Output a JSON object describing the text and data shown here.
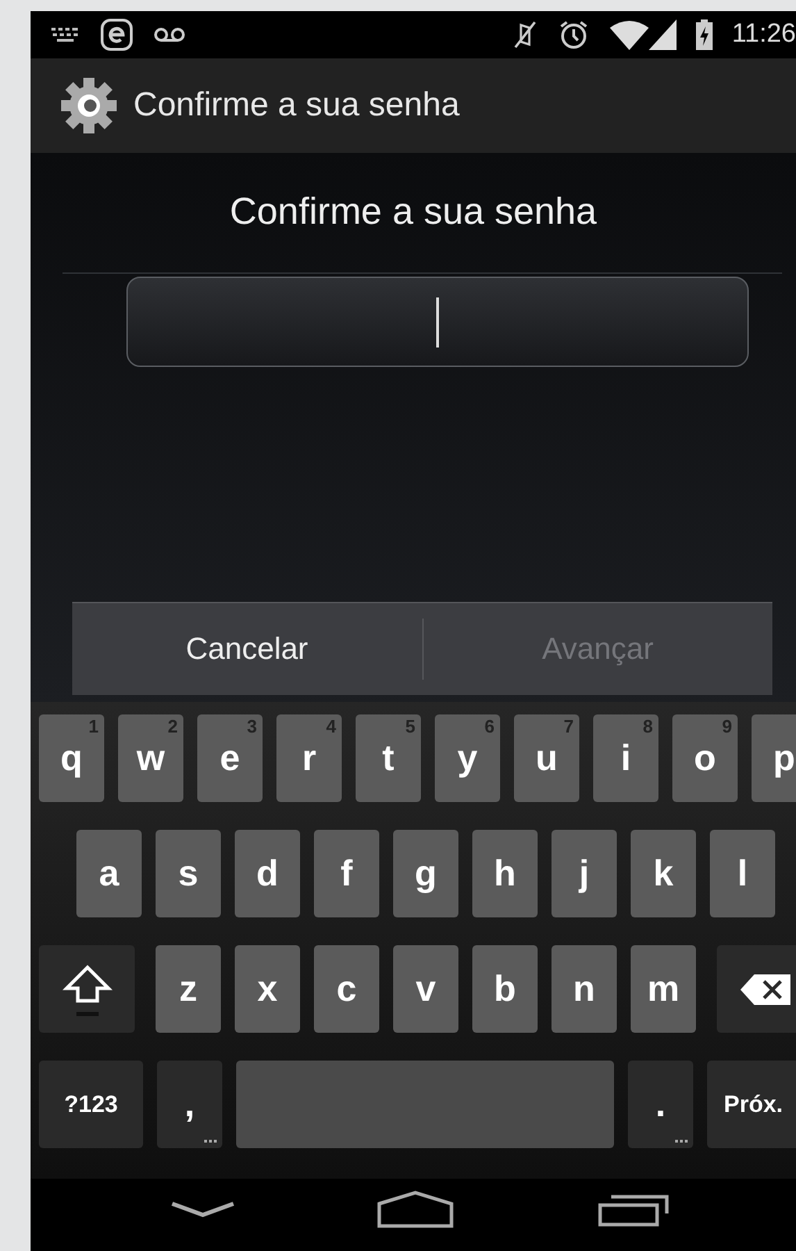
{
  "status_bar": {
    "time": "11:26"
  },
  "action_bar": {
    "title": "Confirme a sua senha"
  },
  "dialog": {
    "heading": "Confirme a sua senha",
    "password_field": {
      "focused": true
    },
    "buttons": [
      {
        "label": "Cancelar",
        "disabled": false
      },
      {
        "label": "Avançar",
        "disabled": true
      }
    ]
  },
  "keyboard": {
    "rows": [
      {
        "keys": [
          {
            "kind": "letter",
            "label": "q",
            "hint": "1"
          },
          {
            "kind": "letter",
            "label": "w",
            "hint": "2"
          },
          {
            "kind": "letter",
            "label": "e",
            "hint": "3"
          },
          {
            "kind": "letter",
            "label": "r",
            "hint": "4"
          },
          {
            "kind": "letter",
            "label": "t",
            "hint": "5"
          },
          {
            "kind": "letter",
            "label": "y",
            "hint": "6"
          },
          {
            "kind": "letter",
            "label": "u",
            "hint": "7"
          },
          {
            "kind": "letter",
            "label": "i",
            "hint": "8"
          },
          {
            "kind": "letter",
            "label": "o",
            "hint": "9"
          },
          {
            "kind": "letter",
            "label": "p"
          }
        ]
      },
      {
        "keys": [
          {
            "kind": "letter",
            "label": "a"
          },
          {
            "kind": "letter",
            "label": "s"
          },
          {
            "kind": "letter",
            "label": "d"
          },
          {
            "kind": "letter",
            "label": "f"
          },
          {
            "kind": "letter",
            "label": "g"
          },
          {
            "kind": "letter",
            "label": "h"
          },
          {
            "kind": "letter",
            "label": "j"
          },
          {
            "kind": "letter",
            "label": "k"
          },
          {
            "kind": "letter",
            "label": "l"
          }
        ]
      },
      {
        "keys": [
          {
            "kind": "shift",
            "on": false
          },
          {
            "kind": "letter",
            "label": "z"
          },
          {
            "kind": "letter",
            "label": "x"
          },
          {
            "kind": "letter",
            "label": "c"
          },
          {
            "kind": "letter",
            "label": "v"
          },
          {
            "kind": "letter",
            "label": "b"
          },
          {
            "kind": "letter",
            "label": "n"
          },
          {
            "kind": "letter",
            "label": "m"
          },
          {
            "kind": "backspace"
          }
        ]
      },
      {
        "keys": [
          {
            "kind": "symbols",
            "label": "?123"
          },
          {
            "kind": "punct",
            "label": ","
          },
          {
            "kind": "space"
          },
          {
            "kind": "punct",
            "label": "."
          },
          {
            "kind": "action",
            "label": "Próx."
          }
        ]
      }
    ]
  }
}
